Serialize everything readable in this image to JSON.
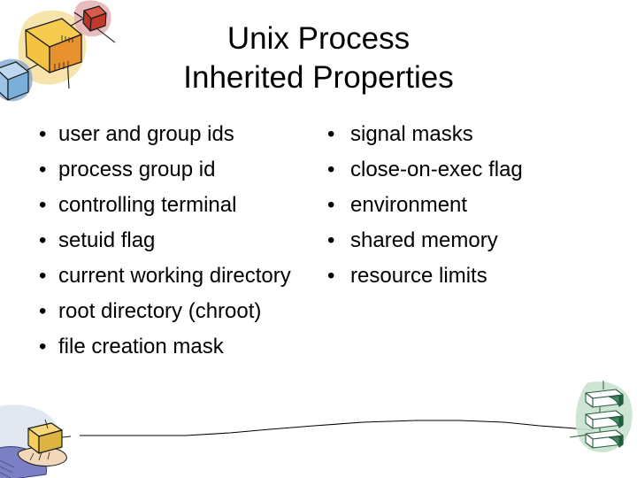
{
  "slide": {
    "title": {
      "line1": "Unix Process",
      "line2": "Inherited Properties",
      "full": "Unix Process Inherited Properties"
    },
    "columns": {
      "left": {
        "bullet_char": "•",
        "items": [
          {
            "text": "user and group ids"
          },
          {
            "text": "process group id"
          },
          {
            "text": "controlling terminal"
          },
          {
            "text": "setuid flag"
          },
          {
            "text": "current working directory"
          },
          {
            "text": "root directory (chroot)"
          },
          {
            "text": "file creation mask"
          }
        ]
      },
      "right": {
        "bullet_char": "•",
        "items": [
          {
            "text": "signal masks"
          },
          {
            "text": "close-on-exec flag"
          },
          {
            "text": "environment"
          },
          {
            "text": "shared memory"
          },
          {
            "text": "resource limits"
          }
        ]
      }
    },
    "decorations": [
      {
        "name": "boxes-cluster-clipart",
        "position": "top-left",
        "description": "three connected 3D boxes with watercolor glow",
        "colors": {
          "center_box_top": "#f7cc4e",
          "center_box_side": "#e8912f",
          "center_glow": "#f6e3a8",
          "red_box": "#c0392b",
          "red_glow": "#e8b3b6",
          "blue_box": "#9dc3e6",
          "blue_glow": "#6f9dd1",
          "outline": "#1a1a1a"
        }
      },
      {
        "name": "hand-holding-box-clipart",
        "position": "bottom-left",
        "description": "hand in blue sleeve holding a small yellow box",
        "colors": {
          "sleeve": "#7b7fc4",
          "sleeve_shadow": "#5a5fa8",
          "skin": "#f2d8b8",
          "box": "#f2cf5c",
          "box_shadow": "#dcb441",
          "wash": "#dfe6ef",
          "outline": "#1a1a1a"
        }
      },
      {
        "name": "green-boxes-stack-clipart",
        "position": "bottom-right",
        "description": "vertical stack of three green 3D boxes with watercolor glow",
        "colors": {
          "box_fill": "#ffffff",
          "box_accent": "#3d8b5f",
          "box_dark": "#1f5c3a",
          "glow": "#c9e2cf",
          "outline": "#2a5c3f"
        }
      },
      {
        "name": "connector-line",
        "position": "bottom-center",
        "description": "thin hand-drawn line from hand to green box stack",
        "colors": {
          "stroke": "#000000"
        }
      }
    ]
  }
}
